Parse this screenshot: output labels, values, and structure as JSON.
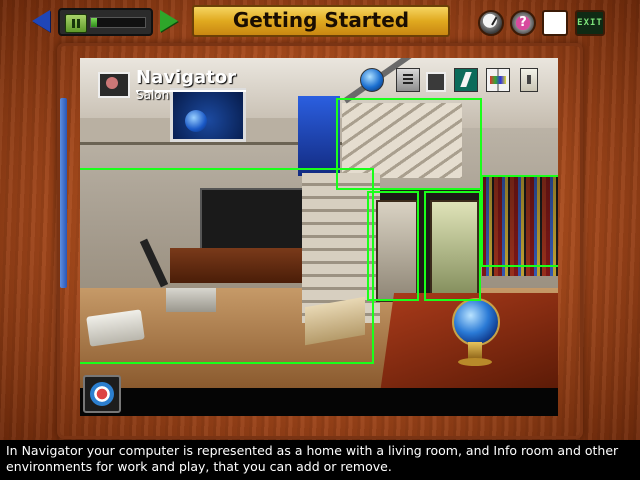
{
  "toolbar": {
    "title": "Getting Started",
    "progress_fraction": 0.12,
    "exit_label": "EXIT",
    "help_label": "?"
  },
  "scene": {
    "heading": "Navigator",
    "subheading": "Salon",
    "icons": [
      "globe-icon",
      "phone-icon",
      "portrait-icon",
      "runner-icon",
      "book-icon",
      "light-switch-icon"
    ],
    "hotspot_color": "#1aff1a"
  },
  "caption": {
    "text": "In Navigator your computer is represented as a home with a living room, and Info room and other environments for work and play, that you can add or remove."
  },
  "colors": {
    "wood": "#a74a1c",
    "title_plate": "#e0a91f",
    "back_arrow": "#1f46b8",
    "forward_arrow": "#2ea62a"
  }
}
